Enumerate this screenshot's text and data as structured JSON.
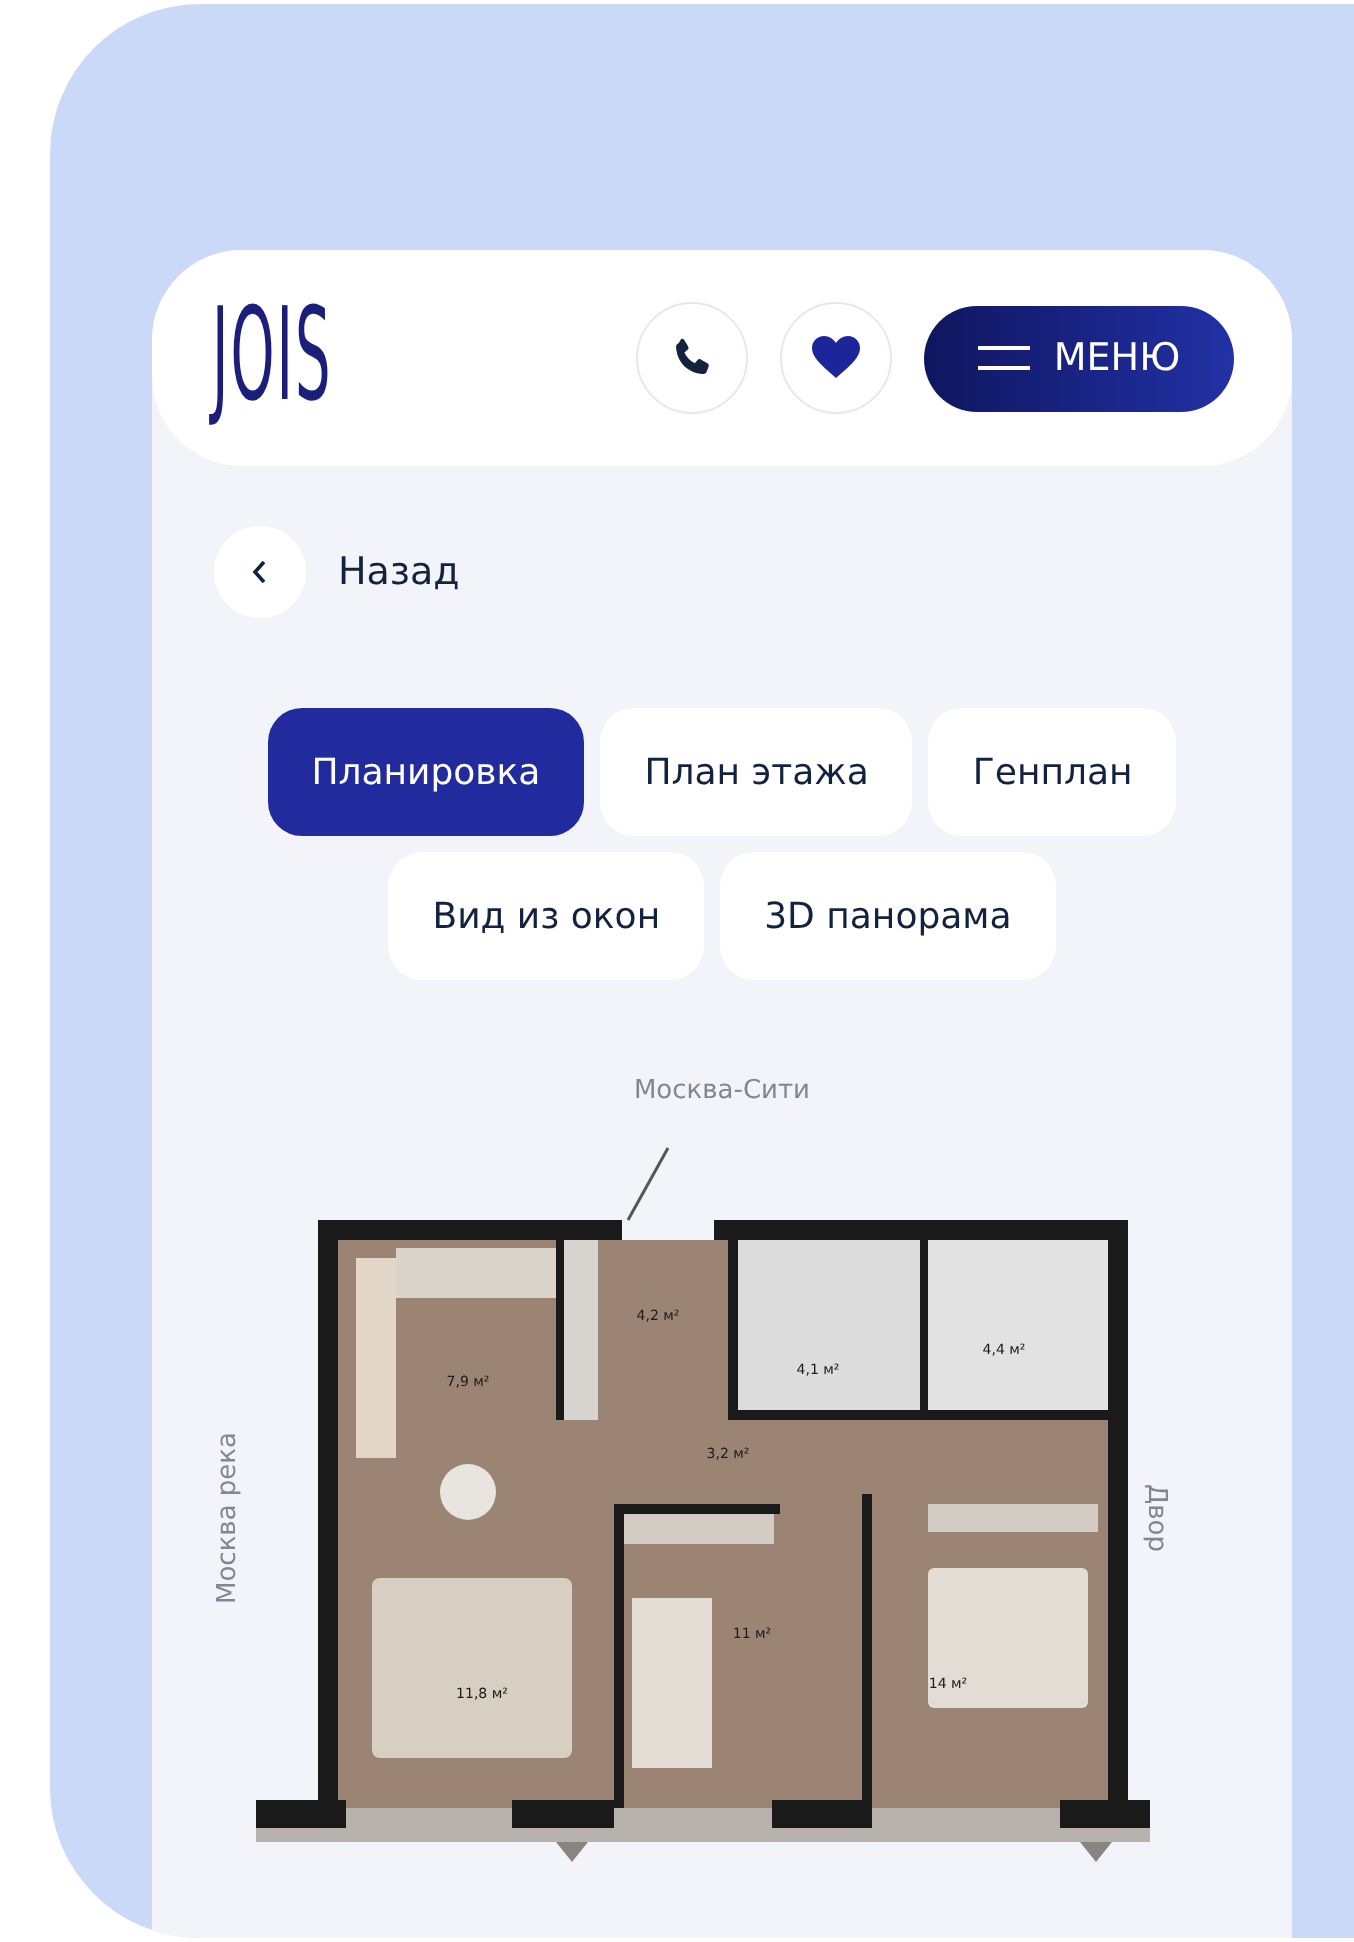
{
  "header": {
    "logo": "JOIS",
    "menu_label": "МЕНЮ"
  },
  "back": {
    "label": "Назад"
  },
  "tabs": [
    {
      "label": "Планировка",
      "selected": true
    },
    {
      "label": "План этажа",
      "selected": false
    },
    {
      "label": "Генплан",
      "selected": false
    },
    {
      "label": "Вид из окон",
      "selected": false
    },
    {
      "label": "3D панорама",
      "selected": false
    }
  ],
  "plan": {
    "top_label": "Москва-Сити",
    "left_label": "Москва река",
    "right_label": "Двор",
    "rooms": [
      {
        "area": "7,9 м²"
      },
      {
        "area": "4,2 м²"
      },
      {
        "area": "4,1 м²"
      },
      {
        "area": "4,4 м²"
      },
      {
        "area": "3,2 м²"
      },
      {
        "area": "11,8 м²"
      },
      {
        "area": "11 м²"
      },
      {
        "area": "14 м²"
      }
    ]
  }
}
